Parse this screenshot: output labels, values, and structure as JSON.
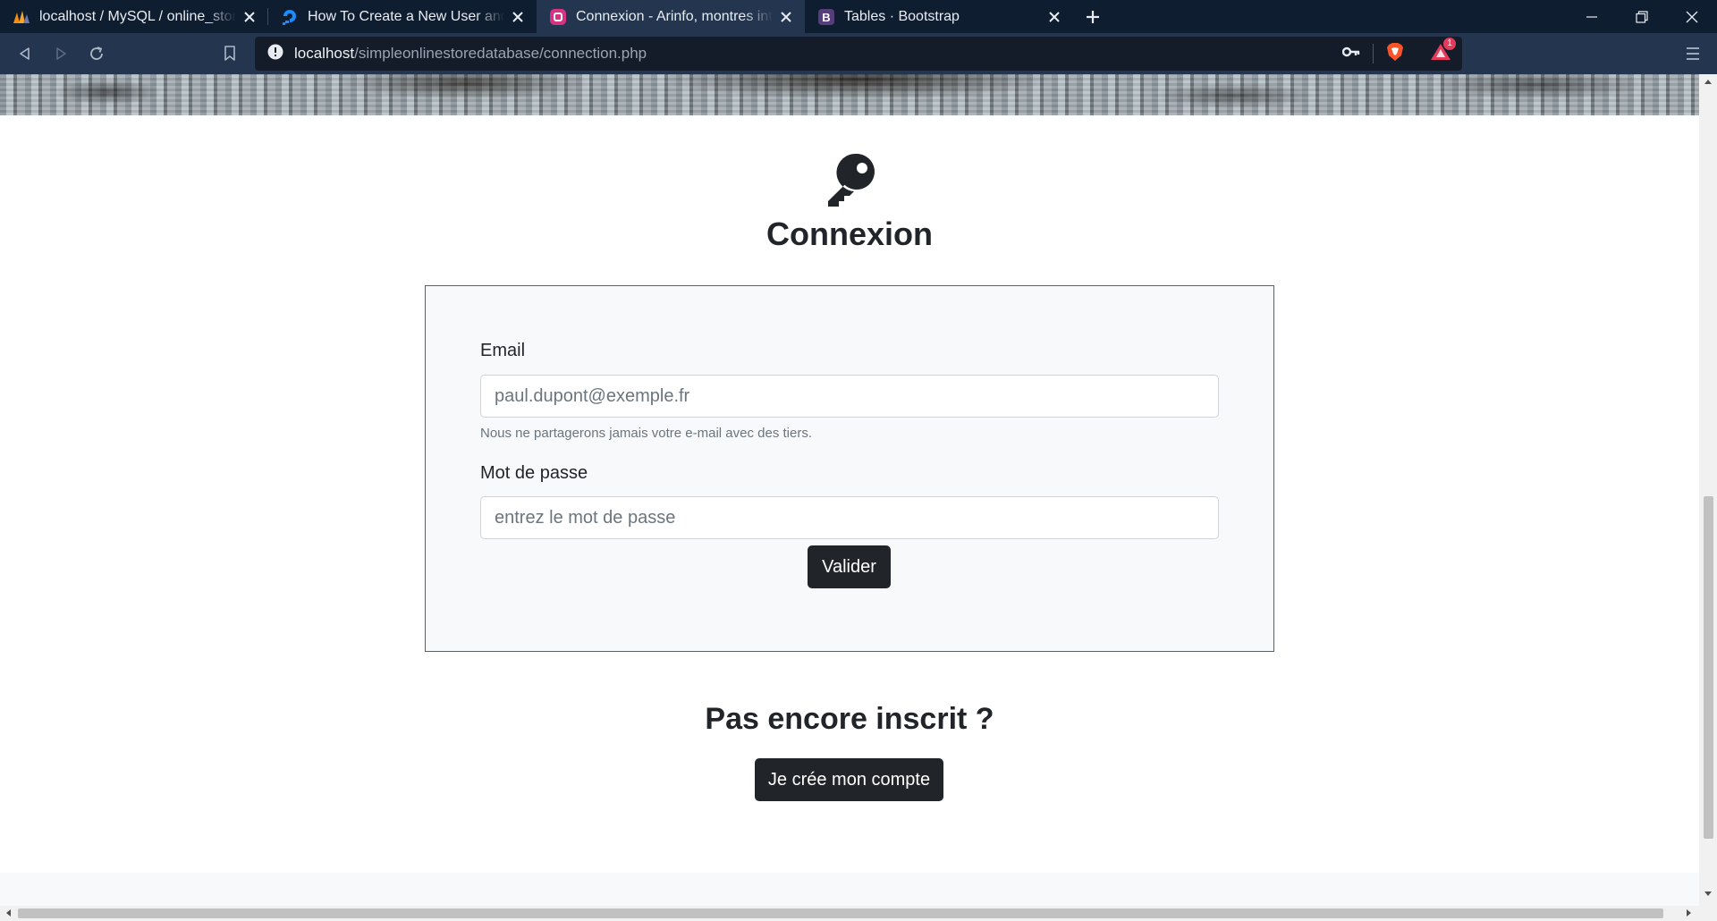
{
  "browser": {
    "tabs": [
      {
        "title": "localhost / MySQL / online_store / ",
        "favicon": "phpmyadmin-icon",
        "active": false
      },
      {
        "title": "How To Create a New User and Grant Permissions in MySQL",
        "favicon": "digitalocean-icon",
        "active": false
      },
      {
        "title": "Connexion - Arinfo, montres intemporelles",
        "favicon": "site-icon",
        "active": true
      },
      {
        "title": "Tables · Bootstrap",
        "favicon": "bootstrap-icon",
        "active": false
      }
    ],
    "url_host": "localhost",
    "url_path": "/simpleonlinestoredatabase/connection.php",
    "alert_count": "1",
    "colors": {
      "tabbar": "#0f1d30",
      "toolbar": "#23354f",
      "urlbar": "#131c28",
      "brave": "#fb542b"
    }
  },
  "page": {
    "icon": "key-icon",
    "title": "Connexion",
    "form": {
      "email_label": "Email",
      "email_placeholder": "paul.dupont@exemple.fr",
      "email_value": "",
      "email_hint": "Nous ne partagerons jamais votre e-mail avec des tiers.",
      "password_label": "Mot de passe",
      "password_placeholder": "entrez le mot de passe",
      "password_value": "",
      "submit_label": "Valider"
    },
    "signup_prompt": "Pas encore inscrit ?",
    "signup_button": "Je crée mon compte",
    "colors": {
      "text": "#212529",
      "button": "#212529",
      "card": "#f8f9fa",
      "muted": "#6c757d"
    }
  }
}
